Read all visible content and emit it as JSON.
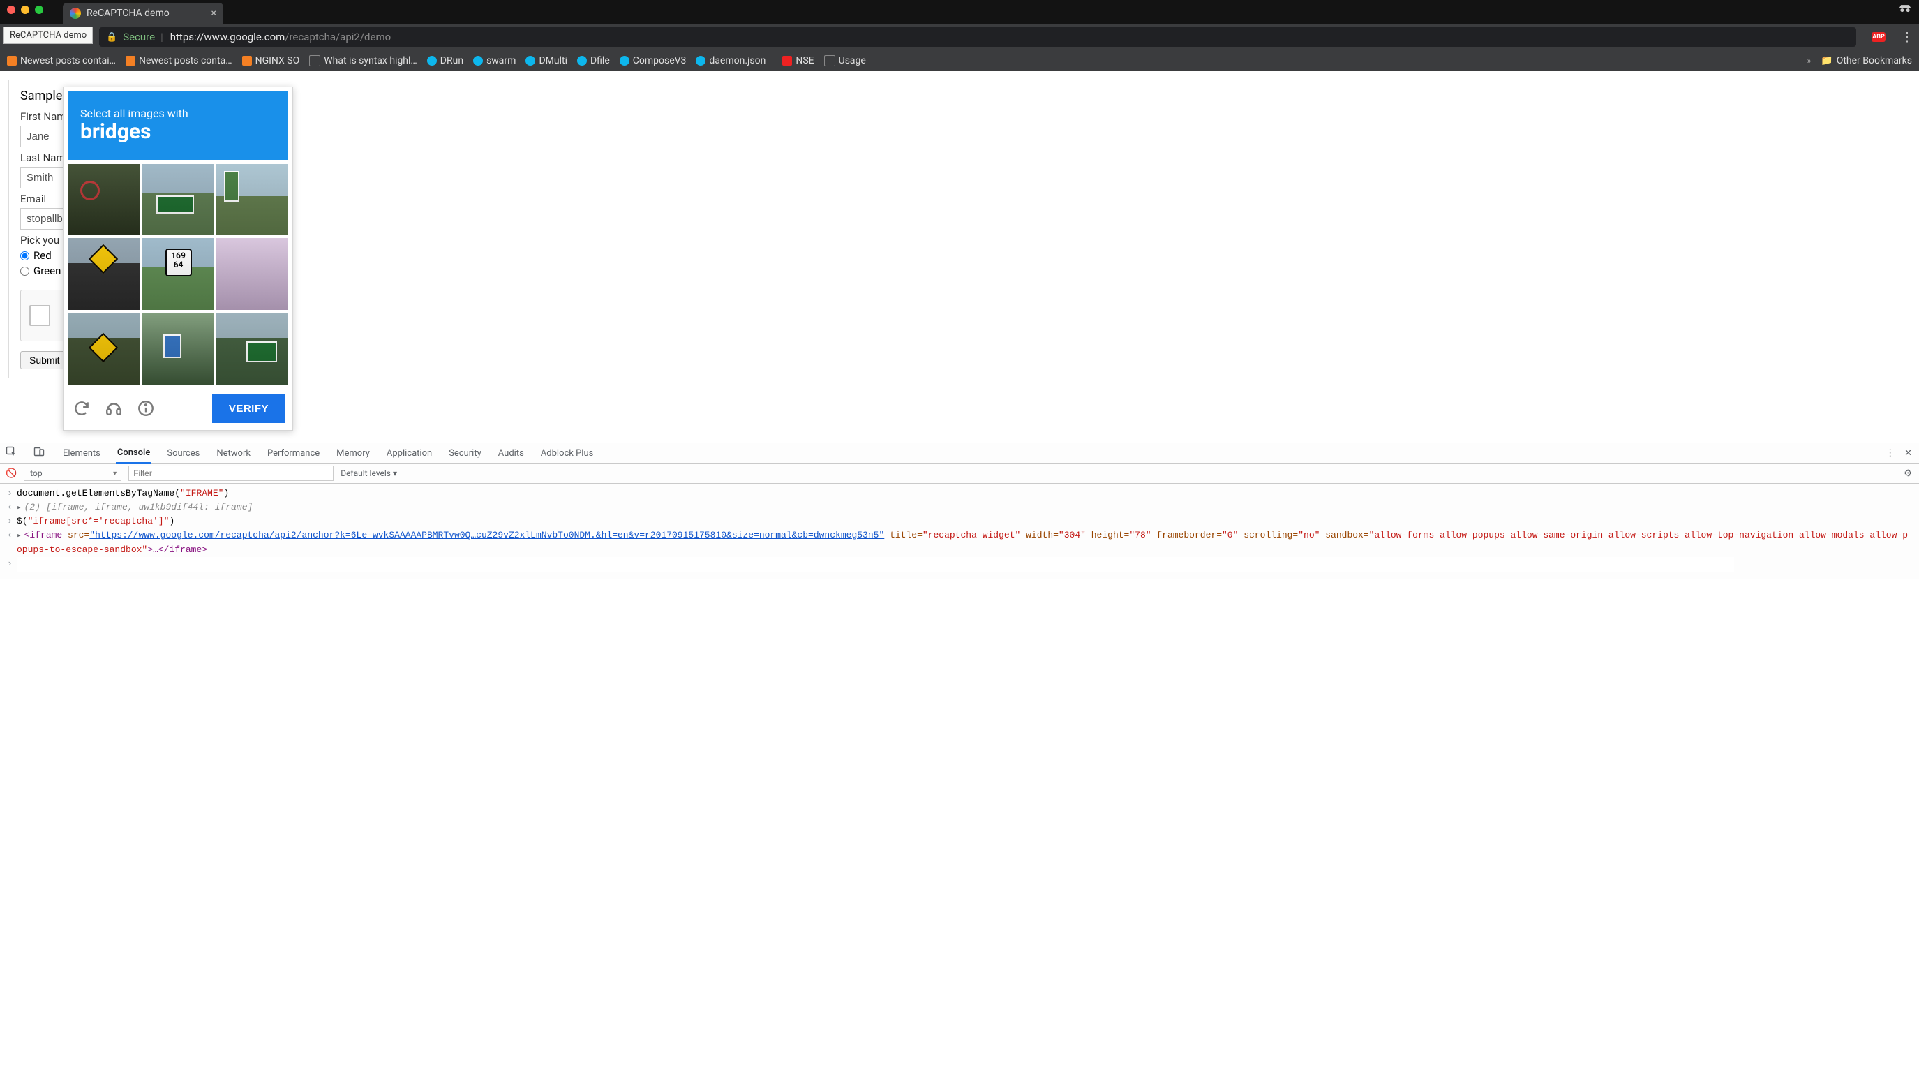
{
  "browser": {
    "tab_title": "ReCAPTCHA demo",
    "tab_tooltip": "ReCAPTCHA demo",
    "secure_label": "Secure",
    "url_host": "https://www.google.com",
    "url_path": "/recaptcha/api2/demo",
    "abp_label": "ABP"
  },
  "bookmarks": {
    "items": [
      "Newest posts contai…",
      "Newest posts conta…",
      "NGINX SO",
      "What is syntax highl…",
      "DRun",
      "swarm",
      "DMulti",
      "Dfile",
      "ComposeV3",
      "daemon.json",
      "NSE",
      "Usage"
    ],
    "overflow": "»",
    "other": "Other Bookmarks"
  },
  "form": {
    "heading": "Sample",
    "first_name_label": "First Nam",
    "first_name_value": "Jane",
    "last_name_label": "Last Nam",
    "last_name_value": "Smith",
    "email_label": "Email",
    "email_value": "stopallb",
    "pick_label": "Pick you",
    "radio_red": "Red",
    "radio_green": "Green",
    "submit_label": "Submit"
  },
  "captcha": {
    "line1": "Select all images with",
    "line2": "bridges",
    "shield_text": "169\n64",
    "verify_label": "VERIFY"
  },
  "devtools": {
    "tabs": [
      "Elements",
      "Console",
      "Sources",
      "Network",
      "Performance",
      "Memory",
      "Application",
      "Security",
      "Audits",
      "Adblock Plus"
    ],
    "active_tab": "Console",
    "context": "top",
    "filter_placeholder": "Filter",
    "levels": "Default levels ▾"
  },
  "console": {
    "l1": "document.getElementsByTagName(",
    "l1_arg": "\"IFRAME\"",
    "l1_close": ")",
    "l2_pre": "(2) ",
    "l2_body": "[iframe, iframe, uw1kb9dif44l: iframe]",
    "l3": "$(",
    "l3_arg": "\"iframe[src*='recaptcha']\"",
    "l3_close": ")",
    "l4": {
      "open": "<iframe ",
      "src_attr": "src=",
      "src_val": "\"https://www.google.com/recaptcha/api2/anchor?k=6Le-wvkSAAAAAPBMRTvw0Q…cuZ29vZ2xlLmNvbTo0NDM.&hl=en&v=r20170915175810&size=normal&cb=dwnckmeg53n5\"",
      "title_attr": " title=",
      "title_val": "\"recaptcha widget\"",
      "width_attr": " width=",
      "width_val": "\"304\"",
      "height_attr": " height=",
      "height_val": "\"78\"",
      "fb_attr": " frameborder=",
      "fb_val": "\"0\"",
      "scroll_attr": " scrolling=",
      "scroll_val": "\"no\"",
      "sb_attr": " sandbox=",
      "sb_val": "\"allow-forms allow-popups allow-same-origin allow-scripts allow-top-navigation allow-modals allow-popups-to-escape-sandbox\"",
      "tail": ">…</iframe>"
    }
  }
}
